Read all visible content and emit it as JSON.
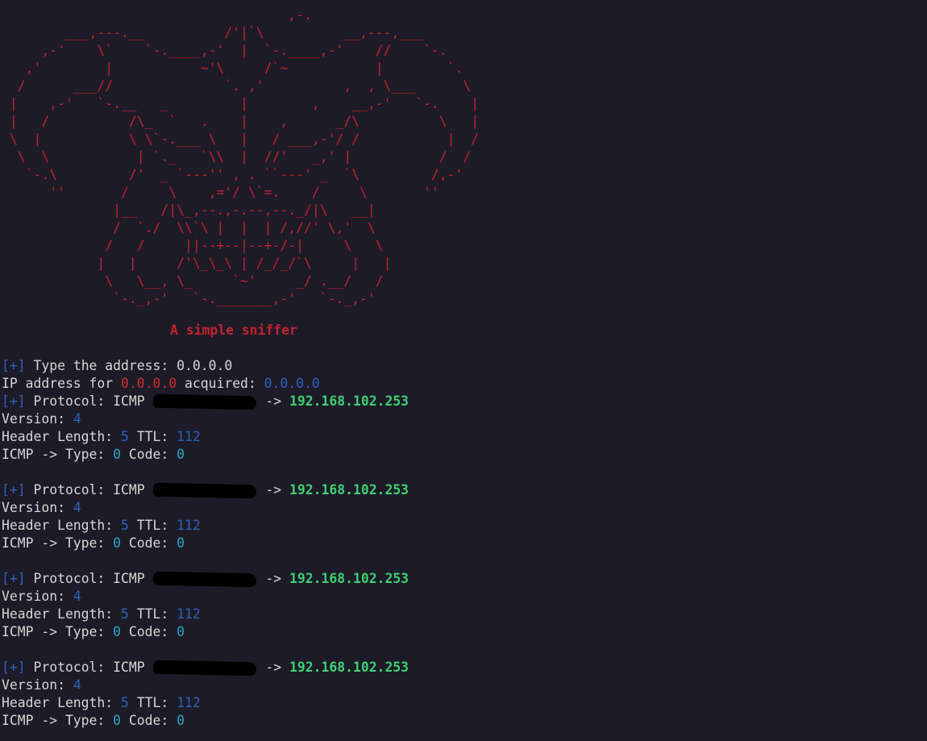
{
  "banner": {
    "art": "                                    ,-.\n        ___,---.__          /'|`\\          __,---,___\n     ,-'    \\`    `-.____,-'  |  `-.____,-'    //    `-.\n   ,'        |           ~'\\     /`~           |        `.\n  /      ___//              `. ,'          ,  , \\___      \\\n |    ,-'   `-.__   _         |        ,    __,-'   `-.    |\n |   /          /\\_  `   .    |    ,      _/\\          \\   |\n \\  |           \\ \\`-.___ \\   |   / ___,-'/ /           |  /\n  \\  \\           | `._   `\\\\  |  //'   _,' |           /  /\n   `-.\\         /'  _ `---'' , . ``---' _  `\\         /,-'\n      ''       /     \\    ,='/ \\`=.    /     \\       ''\n              |__   /|\\_,--.,-.--,--._/|\\   __|\n              /  `./  \\\\`\\ |  |  | /,//' \\,'  \\\n             /   /     ||--+--|--+-/-|     \\   \\\n            |   |     /'\\_\\_\\ | /_/_/`\\     |   |\n             \\   \\__, \\_     `~'     _/ .__/   /\n              `-._,-'   `-._______,-'   `-._,-'",
    "subtitle": "A simple sniffer"
  },
  "prompt": {
    "marker": "[+]",
    "label": "Type the address:",
    "value": "0.0.0.0"
  },
  "acquired": {
    "prefix": "IP address for",
    "address": "0.0.0.0",
    "middle": "acquired:",
    "resolved": "0.0.0.0"
  },
  "labels": {
    "marker": "[+]",
    "protocol": "Protocol:",
    "arrow": "->",
    "version": "Version:",
    "header_length": "Header Length:",
    "ttl": "TTL:",
    "icmp_prefix": "ICMP -> Type:",
    "code": "Code:"
  },
  "packets": [
    {
      "protocol": "ICMP",
      "destination": "192.168.102.253",
      "version": "4",
      "header_length": "5",
      "ttl": "112",
      "type": "0",
      "code": "0"
    },
    {
      "protocol": "ICMP",
      "destination": "192.168.102.253",
      "version": "4",
      "header_length": "5",
      "ttl": "112",
      "type": "0",
      "code": "0"
    },
    {
      "protocol": "ICMP",
      "destination": "192.168.102.253",
      "version": "4",
      "header_length": "5",
      "ttl": "112",
      "type": "0",
      "code": "0"
    },
    {
      "protocol": "ICMP",
      "destination": "192.168.102.253",
      "version": "4",
      "header_length": "5",
      "ttl": "112",
      "type": "0",
      "code": "0"
    }
  ],
  "colors": {
    "background": "#1c1b27",
    "banner": "#c4222f",
    "marker": "#2e63b8",
    "destination": "#3fcf74",
    "value": "#2e63b8",
    "icmp_value": "#2aa6c6"
  }
}
